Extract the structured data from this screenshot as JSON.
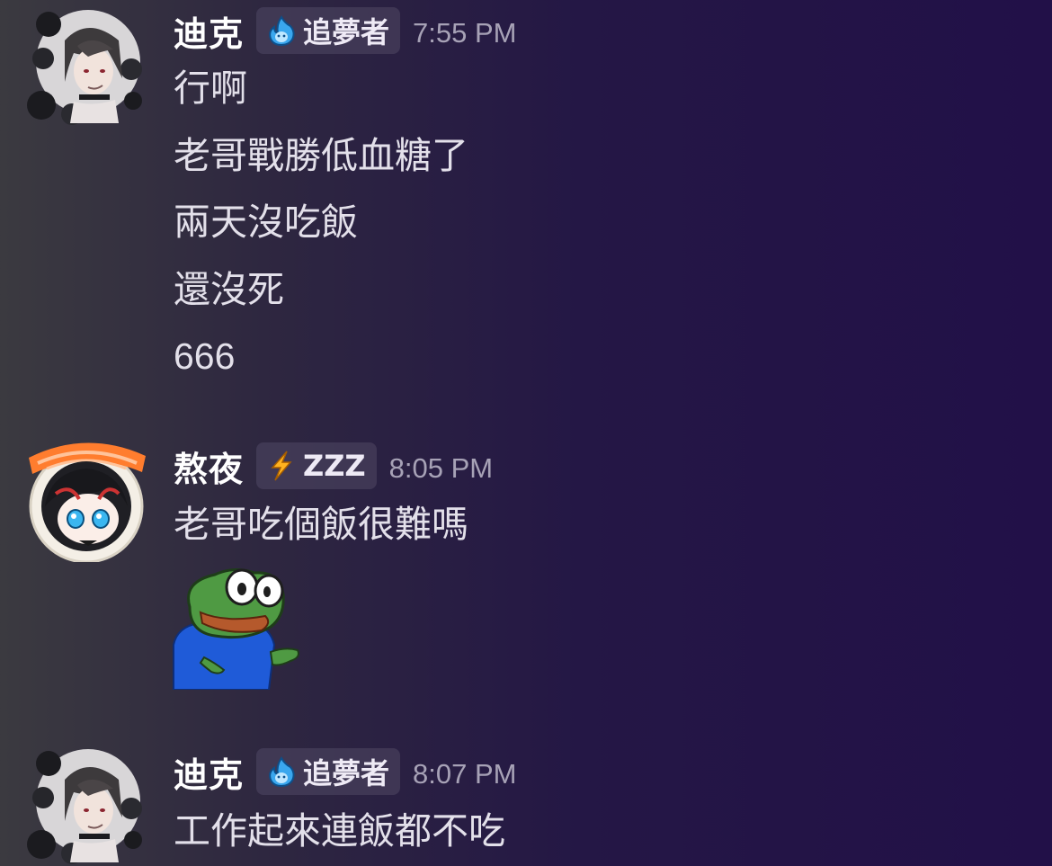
{
  "messages": [
    {
      "username": "迪克",
      "role_tag": "追夢者",
      "role_icon": "blue-flame-icon",
      "timestamp": "7:55 PM",
      "lines": [
        "行啊",
        "老哥戰勝低血糖了",
        "兩天沒吃飯",
        "還沒死",
        "666"
      ]
    },
    {
      "username": "熬夜",
      "role_tag": "ZZZ",
      "role_icon": "lightning-icon",
      "timestamp": "8:05 PM",
      "lines": [
        "老哥吃個飯很難嗎"
      ],
      "sticker": "pepe-shrug-sticker"
    },
    {
      "username": "迪克",
      "role_tag": "追夢者",
      "role_icon": "blue-flame-icon",
      "timestamp": "8:07 PM",
      "lines": [
        "工作起來連飯都不吃"
      ]
    }
  ],
  "colors": {
    "background_start": "#3b3a40",
    "background_end": "#221048",
    "username": "#ffffff",
    "message_text": "#e3e0ea",
    "timestamp": "#a7a2b6",
    "role_tag_bg": "#4e4466"
  }
}
